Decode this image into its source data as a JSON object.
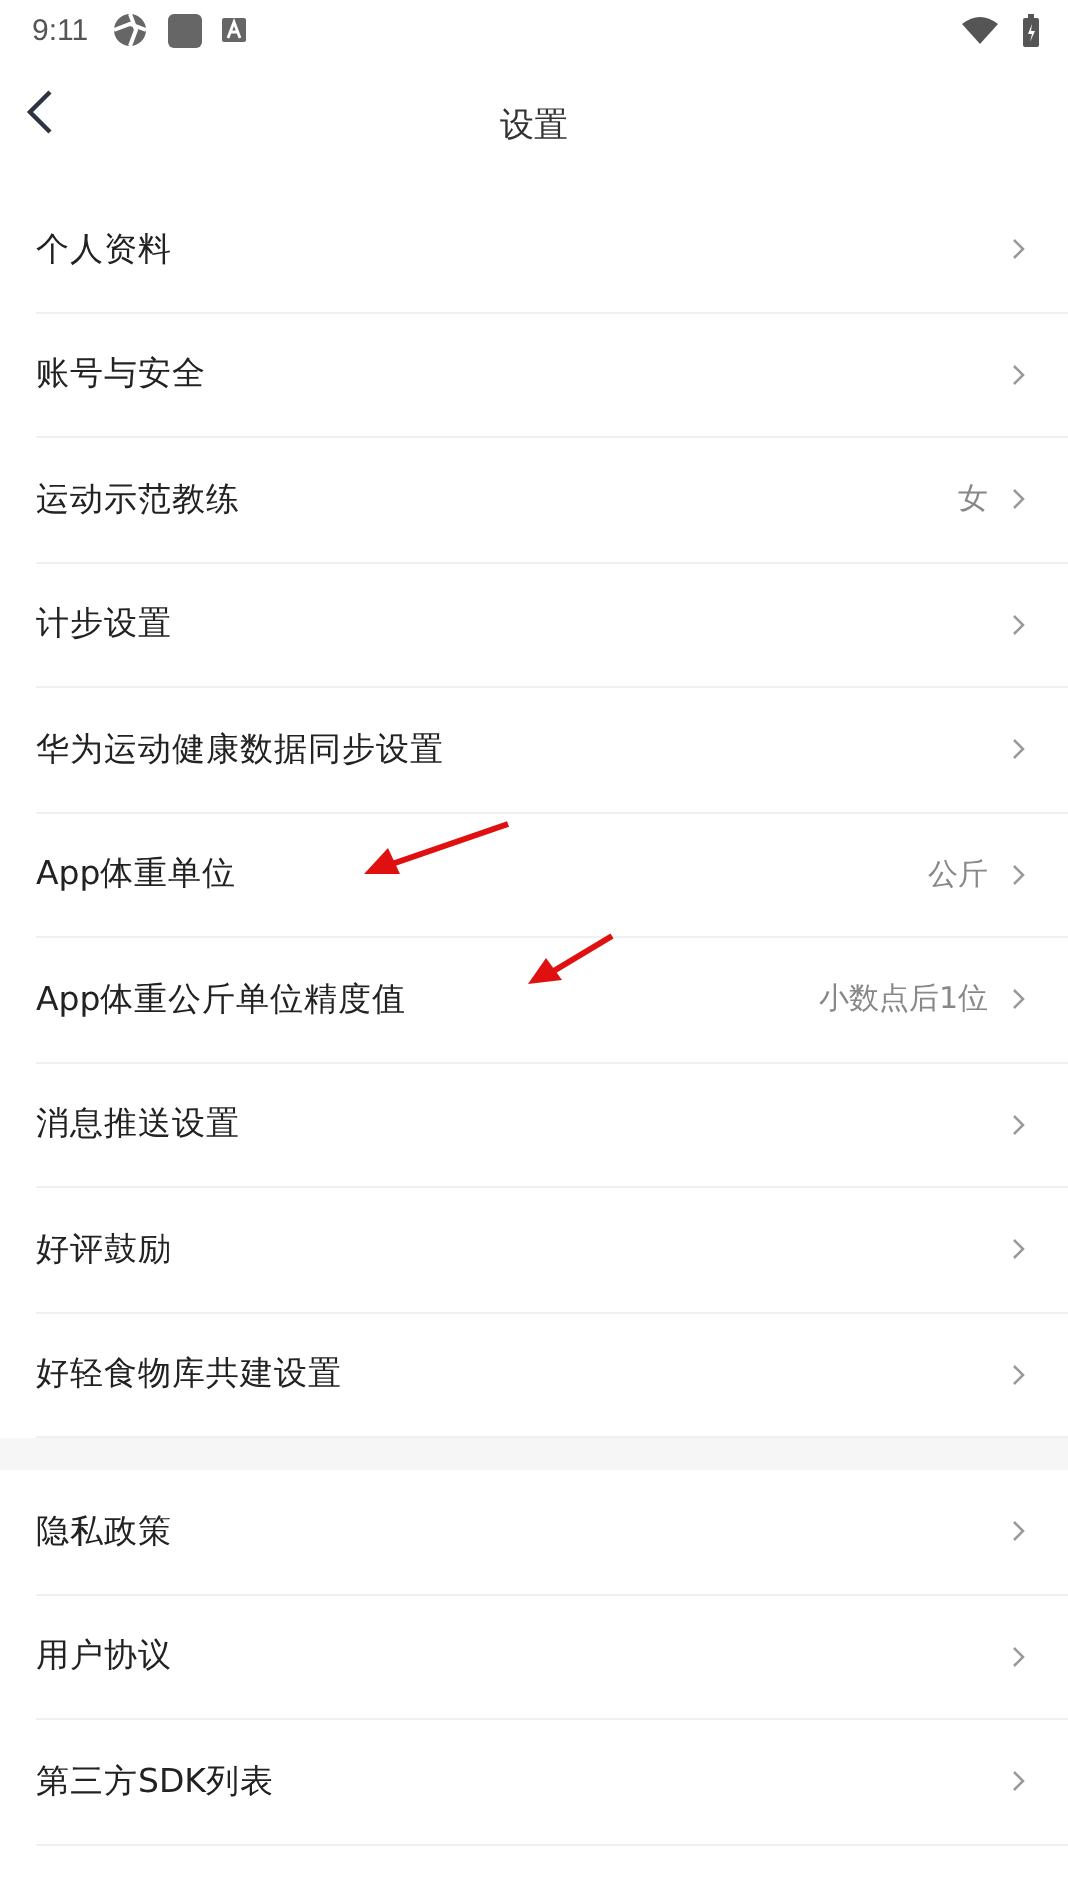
{
  "status_bar": {
    "time": "9:11"
  },
  "header": {
    "title": "设置"
  },
  "groups": [
    {
      "items": [
        {
          "label": "个人资料"
        },
        {
          "label": "账号与安全"
        },
        {
          "label": "运动示范教练",
          "value": "女"
        },
        {
          "label": "计步设置"
        },
        {
          "label": "华为运动健康数据同步设置"
        },
        {
          "label": "App体重单位",
          "value": "公斤"
        },
        {
          "label": "App体重公斤单位精度值",
          "value": "小数点后1位"
        },
        {
          "label": "消息推送设置"
        },
        {
          "label": "好评鼓励"
        },
        {
          "label": "好轻食物库共建设置"
        }
      ]
    },
    {
      "items": [
        {
          "label": "隐私政策"
        },
        {
          "label": "用户协议"
        },
        {
          "label": "第三方SDK列表"
        }
      ]
    }
  ]
}
